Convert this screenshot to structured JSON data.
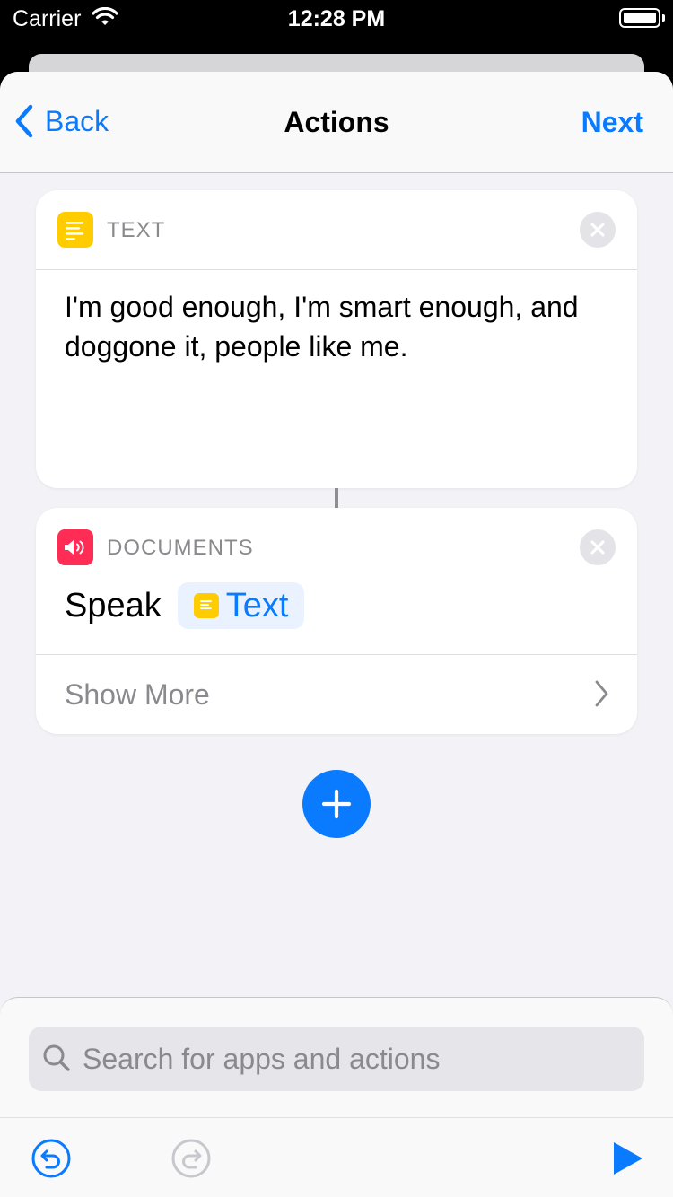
{
  "status_bar": {
    "carrier": "Carrier",
    "time": "12:28 PM"
  },
  "nav": {
    "back_label": "Back",
    "title": "Actions",
    "next_label": "Next"
  },
  "actions": [
    {
      "category": "TEXT",
      "icon": "text-lines-icon",
      "icon_color": "#ffcc00",
      "body": "I'm good enough, I'm smart enough, and doggone it, people like me."
    },
    {
      "category": "DOCUMENTS",
      "icon": "speaker-icon",
      "icon_color": "#ff2d55",
      "verb": "Speak",
      "token_label": "Text",
      "show_more": "Show More"
    }
  ],
  "search": {
    "placeholder": "Search for apps and actions"
  },
  "colors": {
    "accent": "#0a7aff",
    "background": "#f2f2f7"
  }
}
